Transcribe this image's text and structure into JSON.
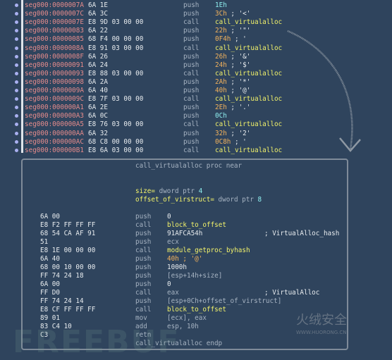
{
  "listing": [
    {
      "addr": "seg000:0000007A",
      "bytes": "6A 1E",
      "mn": "push",
      "op": "1Eh",
      "op_color": "cy"
    },
    {
      "addr": "seg000:0000007C",
      "bytes": "6A 3C",
      "mn": "push",
      "op": "3Ch",
      "op_color": "org",
      "cmt": " ; '<'"
    },
    {
      "addr": "seg000:0000007E",
      "bytes": "E8 9D 03 00 00",
      "mn": "call",
      "op": "call_virtualalloc",
      "op_color": "yel"
    },
    {
      "addr": "seg000:00000083",
      "bytes": "6A 22",
      "mn": "push",
      "op": "22h",
      "op_color": "org",
      "cmt": " ; '\"'"
    },
    {
      "addr": "seg000:00000085",
      "bytes": "68 F4 00 00 00",
      "mn": "push",
      "op": "0F4h",
      "op_color": "org",
      "cmt": " ; '"
    },
    {
      "addr": "seg000:0000008A",
      "bytes": "E8 91 03 00 00",
      "mn": "call",
      "op": "call_virtualalloc",
      "op_color": "yel"
    },
    {
      "addr": "seg000:0000008F",
      "bytes": "6A 26",
      "mn": "push",
      "op": "26h",
      "op_color": "org",
      "cmt": " ; '&'"
    },
    {
      "addr": "seg000:00000091",
      "bytes": "6A 24",
      "mn": "push",
      "op": "24h",
      "op_color": "org",
      "cmt": " ; '$'"
    },
    {
      "addr": "seg000:00000093",
      "bytes": "E8 88 03 00 00",
      "mn": "call",
      "op": "call_virtualalloc",
      "op_color": "yel"
    },
    {
      "addr": "seg000:00000098",
      "bytes": "6A 2A",
      "mn": "push",
      "op": "2Ah",
      "op_color": "org",
      "cmt": " ; '*'"
    },
    {
      "addr": "seg000:0000009A",
      "bytes": "6A 40",
      "mn": "push",
      "op": "40h",
      "op_color": "org",
      "cmt": " ; '@'"
    },
    {
      "addr": "seg000:0000009C",
      "bytes": "E8 7F 03 00 00",
      "mn": "call",
      "op": "call_virtualalloc",
      "op_color": "yel"
    },
    {
      "addr": "seg000:000000A1",
      "bytes": "6A 2E",
      "mn": "push",
      "op": "2Eh",
      "op_color": "org",
      "cmt": " ; '.'"
    },
    {
      "addr": "seg000:000000A3",
      "bytes": "6A 0C",
      "mn": "push",
      "op": "0Ch",
      "op_color": "cy"
    },
    {
      "addr": "seg000:000000A5",
      "bytes": "E8 76 03 00 00",
      "mn": "call",
      "op": "call_virtualalloc",
      "op_color": "yel"
    },
    {
      "addr": "seg000:000000AA",
      "bytes": "6A 32",
      "mn": "push",
      "op": "32h",
      "op_color": "org",
      "cmt": " ; '2'"
    },
    {
      "addr": "seg000:000000AC",
      "bytes": "68 C8 00 00 00",
      "mn": "push",
      "op": "0C8h",
      "op_color": "org",
      "cmt": " ; '"
    },
    {
      "addr": "seg000:000000B1",
      "bytes": "E8 6A 03 00 00",
      "mn": "call",
      "op": "call_virtualalloc",
      "op_color": "yel"
    }
  ],
  "proc": {
    "header": "call_virtualalloc proc near",
    "args": [
      {
        "name": "size=",
        "type": " dword ptr ",
        "val": "4"
      },
      {
        "name": "offset_of_virstruct=",
        "type": " dword ptr ",
        "val": "8"
      }
    ],
    "lines": [
      {
        "bytes": "6A 00",
        "mn": "push",
        "op": "0",
        "op_color": "wh"
      },
      {
        "bytes": "E8 F2 FF FF FF",
        "mn": "call",
        "op": "block_to_offset",
        "op_color": "yel"
      },
      {
        "bytes": "68 54 CA AF 91",
        "mn": "push",
        "op": "91AFCA54h",
        "op_color": "wh",
        "cmt": "; VirtualAlloc_hash"
      },
      {
        "bytes": "51",
        "mn": "push",
        "op": "ecx",
        "op_color": "gr"
      },
      {
        "bytes": "E8 1E 00 00 00",
        "mn": "call",
        "op": "module_getproc_byhash",
        "op_color": "yel"
      },
      {
        "bytes": "6A 40",
        "mn": "push",
        "op": "40h ; '@'",
        "op_color": "org"
      },
      {
        "bytes": "68 00 10 00 00",
        "mn": "push",
        "op": "1000h",
        "op_color": "wh"
      },
      {
        "bytes": "FF 74 24 18",
        "mn": "push",
        "op": "[esp+14h+size]",
        "op_color": "gr"
      },
      {
        "bytes": "6A 00",
        "mn": "push",
        "op": "0",
        "op_color": "wh"
      },
      {
        "bytes": "FF D0",
        "mn": "call",
        "op": "eax",
        "op_color": "gr",
        "cmt": "; VirtualAlloc"
      },
      {
        "bytes": "FF 74 24 14",
        "mn": "push",
        "op": "[esp+0Ch+offset_of_virstruct]",
        "op_color": "gr"
      },
      {
        "bytes": "E8 CF FF FF FF",
        "mn": "call",
        "op": "block_to_offset",
        "op_color": "yel"
      },
      {
        "bytes": "89 01",
        "mn": "mov",
        "op": "[ecx], eax",
        "op_color": "gr"
      },
      {
        "bytes": "83 C4 10",
        "mn": "add",
        "op": "esp, 10h",
        "op_color": "gr"
      },
      {
        "bytes": "C3",
        "mn": "retn",
        "op": "",
        "op_color": "gr"
      }
    ],
    "footer": "call_virtualalloc endp"
  },
  "watermarks": {
    "freebuf": "FREEBUF",
    "huorong": "火绒安全",
    "huorong_url": "WWW.HUORONG.CN"
  },
  "colors": {
    "background": "#2f445d",
    "address": "#e58b8b",
    "call_target": "#f2f26a",
    "char_const": "#f2b25c",
    "number": "#8ff0f0"
  }
}
